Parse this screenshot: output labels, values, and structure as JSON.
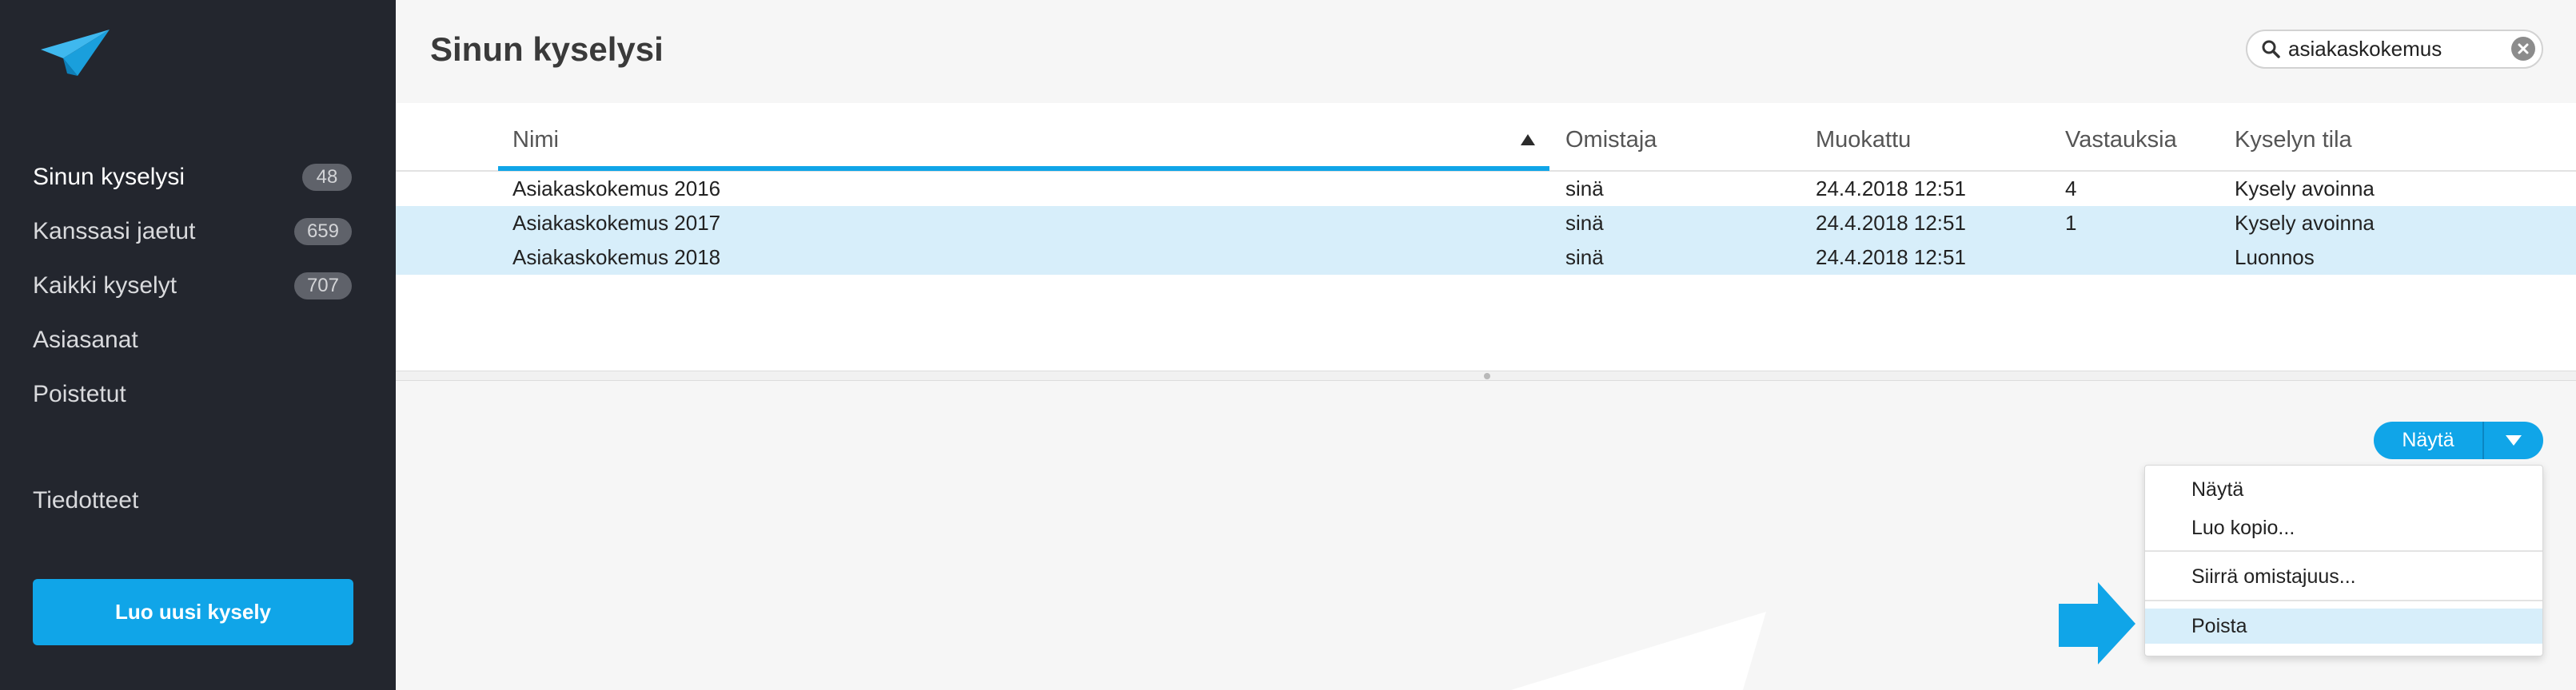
{
  "colors": {
    "accent": "#10a5e8",
    "sidebar_bg": "#23262e",
    "selected_row": "#d7eefa",
    "badge_bg": "#5f626a"
  },
  "icons": {
    "logo": "paper-plane-logo-icon",
    "search": "search-icon",
    "clear": "clear-icon",
    "sort": "sort-ascending-icon",
    "dropdown": "chevron-down-icon",
    "annotation": "arrow-right-icon"
  },
  "sidebar": {
    "items": [
      {
        "label": "Sinun kyselysi",
        "count": "48",
        "active": true
      },
      {
        "label": "Kanssasi jaetut",
        "count": "659",
        "active": false
      },
      {
        "label": "Kaikki kyselyt",
        "count": "707",
        "active": false
      },
      {
        "label": "Asiasanat",
        "active": false
      },
      {
        "label": "Poistetut",
        "active": false
      }
    ],
    "bulletins": "Tiedotteet",
    "new_survey_button": "Luo uusi kysely"
  },
  "header": {
    "title": "Sinun kyselysi"
  },
  "search": {
    "value": "asiakaskokemus"
  },
  "table": {
    "columns": [
      "Nimi",
      "Omistaja",
      "Muokattu",
      "Vastauksia",
      "Kyselyn tila"
    ],
    "rows": [
      {
        "name": "Asiakaskokemus 2016",
        "owner": "sinä",
        "modified": "24.4.2018 12:51",
        "responses": "4",
        "status": "Kysely avoinna",
        "selected": false
      },
      {
        "name": "Asiakaskokemus 2017",
        "owner": "sinä",
        "modified": "24.4.2018 12:51",
        "responses": "1",
        "status": "Kysely avoinna",
        "selected": true
      },
      {
        "name": "Asiakaskokemus 2018",
        "owner": "sinä",
        "modified": "24.4.2018 12:51",
        "responses": "",
        "status": "Luonnos",
        "selected": true
      }
    ]
  },
  "actions": {
    "show_button": "Näytä",
    "menu": [
      {
        "label": "Näytä",
        "highlighted": false
      },
      {
        "label": "Luo kopio...",
        "highlighted": false
      },
      {
        "label": "Siirrä omistajuus...",
        "highlighted": false
      },
      {
        "label": "Poista",
        "highlighted": true
      }
    ]
  }
}
